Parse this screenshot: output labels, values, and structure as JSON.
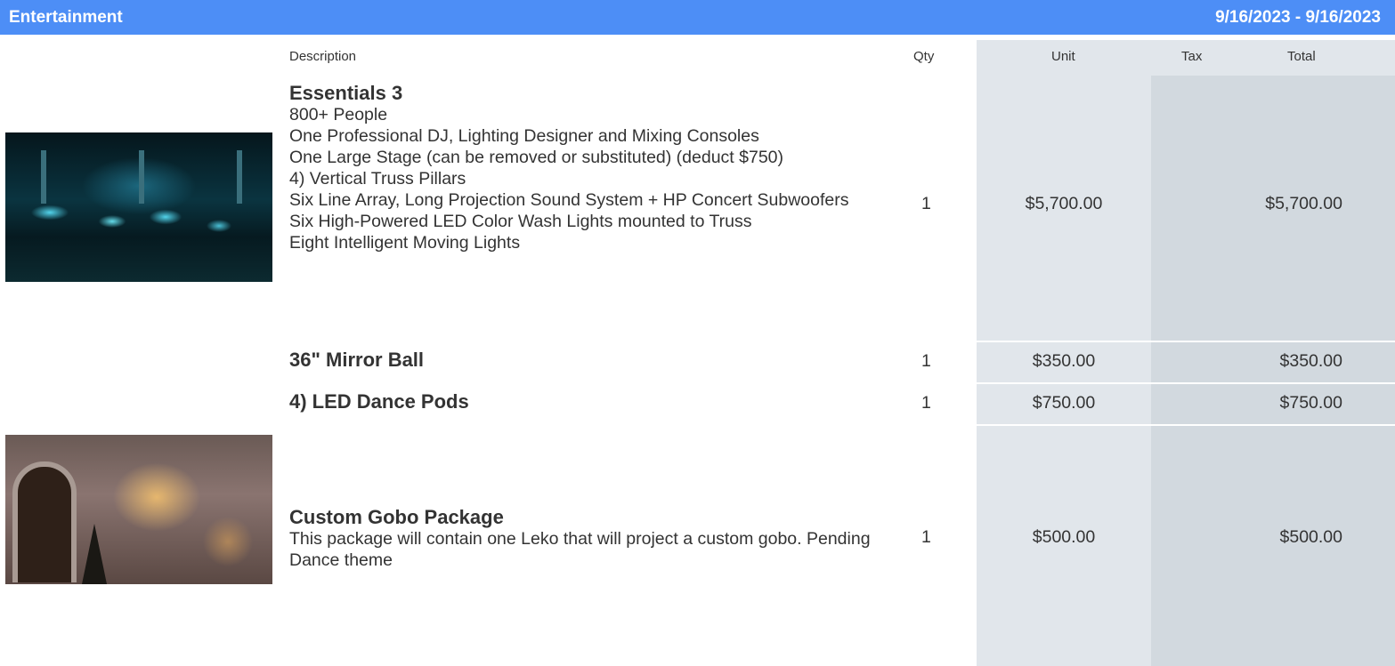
{
  "header": {
    "title": "Entertainment",
    "dates": "9/16/2023 - 9/16/2023"
  },
  "columns": {
    "description": "Description",
    "qty": "Qty",
    "unit": "Unit",
    "tax": "Tax",
    "total": "Total"
  },
  "items": [
    {
      "name": "Essentials 3",
      "lines": [
        "800+ People",
        "One Professional DJ, Lighting Designer and Mixing Consoles",
        "One Large Stage (can be removed or substituted) (deduct $750)",
        "4) Vertical Truss Pillars",
        "Six Line Array, Long Projection Sound System + HP Concert Subwoofers",
        "Six High-Powered LED Color Wash Lights mounted to Truss",
        "Eight Intelligent Moving Lights"
      ],
      "qty": "1",
      "unit": "$5,700.00",
      "tax": "",
      "total": "$5,700.00",
      "image": "concert-crowd-photo"
    },
    {
      "name": "36\" Mirror Ball",
      "lines": [],
      "qty": "1",
      "unit": "$350.00",
      "tax": "",
      "total": "$350.00"
    },
    {
      "name": "4) LED Dance Pods",
      "lines": [],
      "qty": "1",
      "unit": "$750.00",
      "tax": "",
      "total": "$750.00"
    },
    {
      "name": "Custom Gobo Package",
      "lines": [
        "This package will contain one Leko that will project a custom gobo. Pending Dance theme"
      ],
      "qty": "1",
      "unit": "$500.00",
      "tax": "",
      "total": "$500.00",
      "image": "gobo-projection-photo"
    }
  ],
  "colors": {
    "header_bg": "#4d8ef6",
    "unit_column_bg": "#e1e6eb",
    "total_column_bg": "#d2d9df"
  }
}
